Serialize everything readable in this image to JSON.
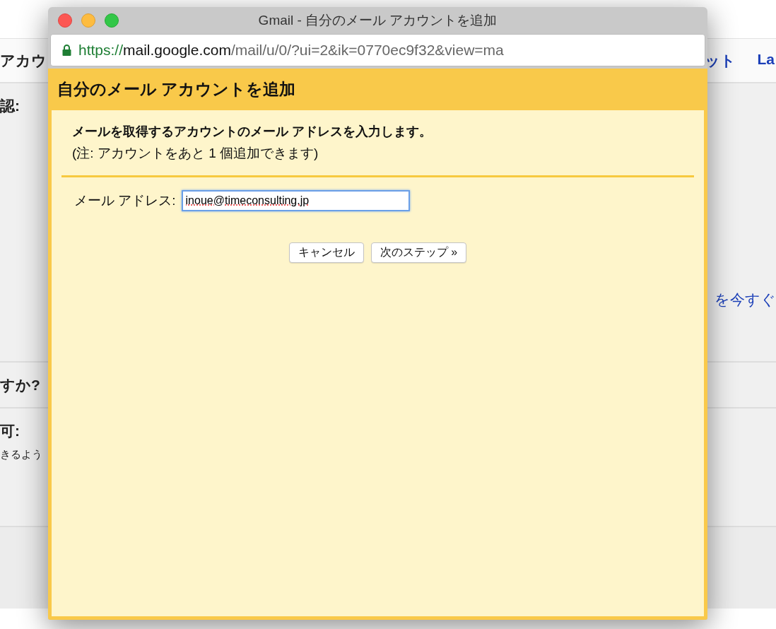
{
  "background_page": {
    "header_left": "アカウ",
    "header_right": [
      "ット",
      "La"
    ],
    "sections": [
      {
        "heading": "認:",
        "link": "を今すぐ"
      },
      {
        "heading": "すか?"
      },
      {
        "heading": "可:",
        "text": "きるよう"
      }
    ]
  },
  "window": {
    "title": "Gmail - 自分のメール アカウントを追加",
    "url": {
      "secure": true,
      "scheme": "https://",
      "host": "mail.google.com",
      "path": "/mail/u/0/?ui=2&ik=0770ec9f32&view=ma"
    }
  },
  "dialog": {
    "title": "自分のメール アカウントを追加",
    "instruction": "メールを取得するアカウントのメール アドレスを入力します。",
    "note": "(注: アカウントをあと 1 個追加できます)",
    "field": {
      "label": "メール アドレス:",
      "value": "inoue@timeconsulting.jp",
      "focused": true,
      "spellcheck_error": true
    },
    "buttons": [
      "キャンセル",
      "次のステップ »"
    ]
  }
}
